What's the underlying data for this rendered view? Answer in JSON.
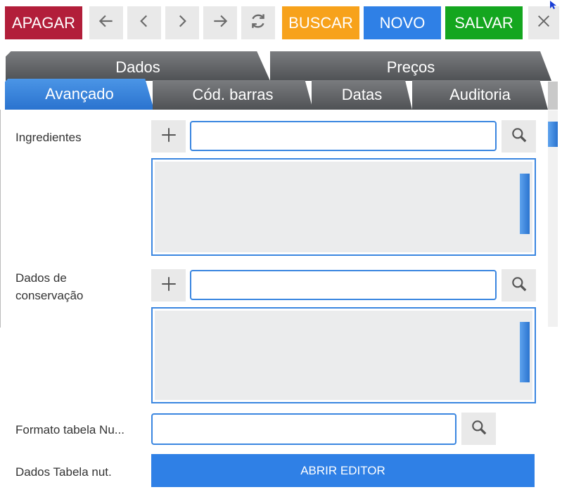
{
  "toolbar": {
    "delete_label": "APAGAR",
    "search_label": "BUSCAR",
    "new_label": "NOVO",
    "save_label": "SALVAR",
    "nav_icons": [
      "arrow-left-icon",
      "chevron-left-icon",
      "chevron-right-icon",
      "arrow-right-icon",
      "refresh-icon",
      "close-icon"
    ]
  },
  "tabs_top": [
    {
      "label": "Dados"
    },
    {
      "label": "Preços"
    }
  ],
  "tabs_sub": [
    {
      "label": "Avançado",
      "active": true
    },
    {
      "label": "Cód. barras"
    },
    {
      "label": "Datas"
    },
    {
      "label": "Auditoria"
    }
  ],
  "fields": {
    "ingredients_label": "Ingredientes",
    "ingredients_value": "",
    "conservation_label": "Dados de\nconservação",
    "conservation_value": "",
    "nutrition_format_label": "Formato tabela Nu...",
    "nutrition_format_value": "",
    "nutrition_data_label": "Dados Tabela nut.",
    "open_editor_label": "ABRIR EDITOR"
  },
  "colors": {
    "delete": "#b21e3a",
    "search": "#f7a21b",
    "new": "#2f80e6",
    "save": "#14a61f",
    "accent": "#3a86e0"
  }
}
